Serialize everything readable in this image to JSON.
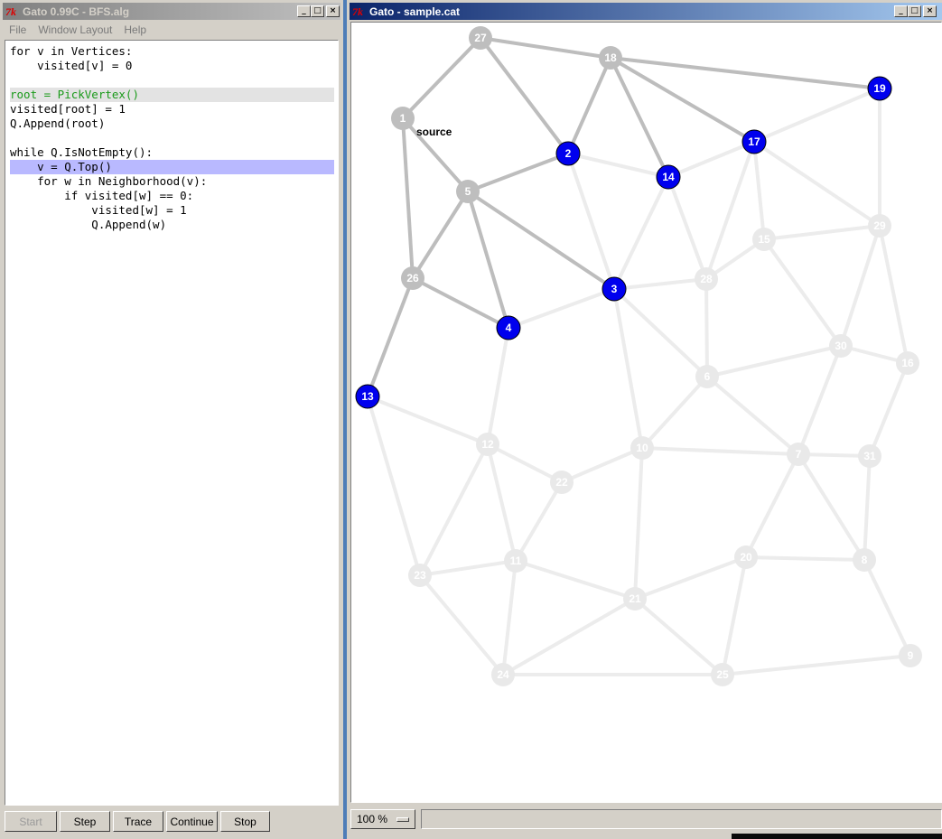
{
  "alg_window": {
    "title": "Gato 0.99C - BFS.alg",
    "menu": [
      "File",
      "Window Layout",
      "Help"
    ],
    "code_lines": [
      {
        "text": "for v in Vertices:",
        "style": "normal"
      },
      {
        "text": "    visited[v] = 0",
        "style": "normal"
      },
      {
        "text": "",
        "style": "normal"
      },
      {
        "text": "root = PickVertex()",
        "style": "green"
      },
      {
        "text": "visited[root] = 1",
        "style": "normal"
      },
      {
        "text": "Q.Append(root)",
        "style": "normal"
      },
      {
        "text": "",
        "style": "normal"
      },
      {
        "text": "while Q.IsNotEmpty():",
        "style": "normal"
      },
      {
        "text": "    v = Q.Top()",
        "style": "current"
      },
      {
        "text": "    for w in Neighborhood(v):",
        "style": "normal"
      },
      {
        "text": "        if visited[w] == 0:",
        "style": "normal"
      },
      {
        "text": "            visited[w] = 1",
        "style": "normal"
      },
      {
        "text": "            Q.Append(w)",
        "style": "normal"
      }
    ],
    "buttons": {
      "start": "Start",
      "step": "Step",
      "trace": "Trace",
      "continue": "Continue",
      "stop": "Stop"
    }
  },
  "graph_window": {
    "title": "Gato - sample.cat",
    "source_label": "source",
    "zoom": "100 %",
    "colors": {
      "blue_vertex": "#0000ee",
      "gray_vertex": "#bebebe",
      "faded_vertex": "#e9e9e9",
      "dark_edge": "#bdbdbd",
      "faded_edge": "#ececec"
    },
    "vertices": [
      {
        "id": "1",
        "state": "gray"
      },
      {
        "id": "2",
        "state": "blue"
      },
      {
        "id": "3",
        "state": "blue"
      },
      {
        "id": "4",
        "state": "blue"
      },
      {
        "id": "5",
        "state": "gray"
      },
      {
        "id": "6",
        "state": "faded"
      },
      {
        "id": "7",
        "state": "faded"
      },
      {
        "id": "8",
        "state": "faded"
      },
      {
        "id": "9",
        "state": "faded"
      },
      {
        "id": "10",
        "state": "faded"
      },
      {
        "id": "11",
        "state": "faded"
      },
      {
        "id": "12",
        "state": "faded"
      },
      {
        "id": "13",
        "state": "blue"
      },
      {
        "id": "14",
        "state": "blue"
      },
      {
        "id": "15",
        "state": "faded"
      },
      {
        "id": "16",
        "state": "faded"
      },
      {
        "id": "17",
        "state": "blue"
      },
      {
        "id": "18",
        "state": "gray"
      },
      {
        "id": "19",
        "state": "blue"
      },
      {
        "id": "20",
        "state": "faded"
      },
      {
        "id": "21",
        "state": "faded"
      },
      {
        "id": "22",
        "state": "faded"
      },
      {
        "id": "23",
        "state": "faded"
      },
      {
        "id": "24",
        "state": "faded"
      },
      {
        "id": "25",
        "state": "faded"
      },
      {
        "id": "26",
        "state": "gray"
      },
      {
        "id": "27",
        "state": "gray"
      },
      {
        "id": "28",
        "state": "faded"
      },
      {
        "id": "29",
        "state": "faded"
      },
      {
        "id": "30",
        "state": "faded"
      },
      {
        "id": "31",
        "state": "faded"
      }
    ],
    "edges": [
      {
        "a": "27",
        "b": "18",
        "state": "dark"
      },
      {
        "a": "27",
        "b": "1",
        "state": "dark"
      },
      {
        "a": "27",
        "b": "2",
        "state": "dark"
      },
      {
        "a": "18",
        "b": "19",
        "state": "dark"
      },
      {
        "a": "18",
        "b": "2",
        "state": "dark"
      },
      {
        "a": "18",
        "b": "14",
        "state": "dark"
      },
      {
        "a": "18",
        "b": "17",
        "state": "dark"
      },
      {
        "a": "1",
        "b": "5",
        "state": "dark"
      },
      {
        "a": "1",
        "b": "26",
        "state": "dark"
      },
      {
        "a": "2",
        "b": "5",
        "state": "dark"
      },
      {
        "a": "5",
        "b": "26",
        "state": "dark"
      },
      {
        "a": "5",
        "b": "4",
        "state": "dark"
      },
      {
        "a": "5",
        "b": "3",
        "state": "dark"
      },
      {
        "a": "26",
        "b": "4",
        "state": "dark"
      },
      {
        "a": "26",
        "b": "13",
        "state": "dark"
      },
      {
        "a": "2",
        "b": "14",
        "state": "faded"
      },
      {
        "a": "2",
        "b": "3",
        "state": "faded"
      },
      {
        "a": "14",
        "b": "17",
        "state": "faded"
      },
      {
        "a": "14",
        "b": "3",
        "state": "faded"
      },
      {
        "a": "14",
        "b": "28",
        "state": "faded"
      },
      {
        "a": "17",
        "b": "19",
        "state": "faded"
      },
      {
        "a": "17",
        "b": "28",
        "state": "faded"
      },
      {
        "a": "17",
        "b": "15",
        "state": "faded"
      },
      {
        "a": "17",
        "b": "29",
        "state": "faded"
      },
      {
        "a": "19",
        "b": "29",
        "state": "faded"
      },
      {
        "a": "15",
        "b": "29",
        "state": "faded"
      },
      {
        "a": "15",
        "b": "28",
        "state": "faded"
      },
      {
        "a": "15",
        "b": "30",
        "state": "faded"
      },
      {
        "a": "29",
        "b": "30",
        "state": "faded"
      },
      {
        "a": "29",
        "b": "16",
        "state": "faded"
      },
      {
        "a": "3",
        "b": "28",
        "state": "faded"
      },
      {
        "a": "3",
        "b": "4",
        "state": "faded"
      },
      {
        "a": "3",
        "b": "10",
        "state": "faded"
      },
      {
        "a": "3",
        "b": "6",
        "state": "faded"
      },
      {
        "a": "28",
        "b": "6",
        "state": "faded"
      },
      {
        "a": "6",
        "b": "30",
        "state": "faded"
      },
      {
        "a": "6",
        "b": "10",
        "state": "faded"
      },
      {
        "a": "6",
        "b": "7",
        "state": "faded"
      },
      {
        "a": "30",
        "b": "16",
        "state": "faded"
      },
      {
        "a": "30",
        "b": "7",
        "state": "faded"
      },
      {
        "a": "16",
        "b": "31",
        "state": "faded"
      },
      {
        "a": "7",
        "b": "31",
        "state": "faded"
      },
      {
        "a": "7",
        "b": "10",
        "state": "faded"
      },
      {
        "a": "7",
        "b": "20",
        "state": "faded"
      },
      {
        "a": "7",
        "b": "8",
        "state": "faded"
      },
      {
        "a": "31",
        "b": "8",
        "state": "faded"
      },
      {
        "a": "4",
        "b": "12",
        "state": "faded"
      },
      {
        "a": "13",
        "b": "12",
        "state": "faded"
      },
      {
        "a": "13",
        "b": "23",
        "state": "faded"
      },
      {
        "a": "12",
        "b": "22",
        "state": "faded"
      },
      {
        "a": "12",
        "b": "11",
        "state": "faded"
      },
      {
        "a": "12",
        "b": "23",
        "state": "faded"
      },
      {
        "a": "22",
        "b": "10",
        "state": "faded"
      },
      {
        "a": "22",
        "b": "11",
        "state": "faded"
      },
      {
        "a": "10",
        "b": "21",
        "state": "faded"
      },
      {
        "a": "11",
        "b": "23",
        "state": "faded"
      },
      {
        "a": "11",
        "b": "21",
        "state": "faded"
      },
      {
        "a": "11",
        "b": "24",
        "state": "faded"
      },
      {
        "a": "23",
        "b": "24",
        "state": "faded"
      },
      {
        "a": "21",
        "b": "24",
        "state": "faded"
      },
      {
        "a": "21",
        "b": "25",
        "state": "faded"
      },
      {
        "a": "21",
        "b": "20",
        "state": "faded"
      },
      {
        "a": "20",
        "b": "8",
        "state": "faded"
      },
      {
        "a": "20",
        "b": "25",
        "state": "faded"
      },
      {
        "a": "8",
        "b": "9",
        "state": "faded"
      },
      {
        "a": "24",
        "b": "25",
        "state": "faded"
      },
      {
        "a": "25",
        "b": "9",
        "state": "faded"
      }
    ]
  }
}
